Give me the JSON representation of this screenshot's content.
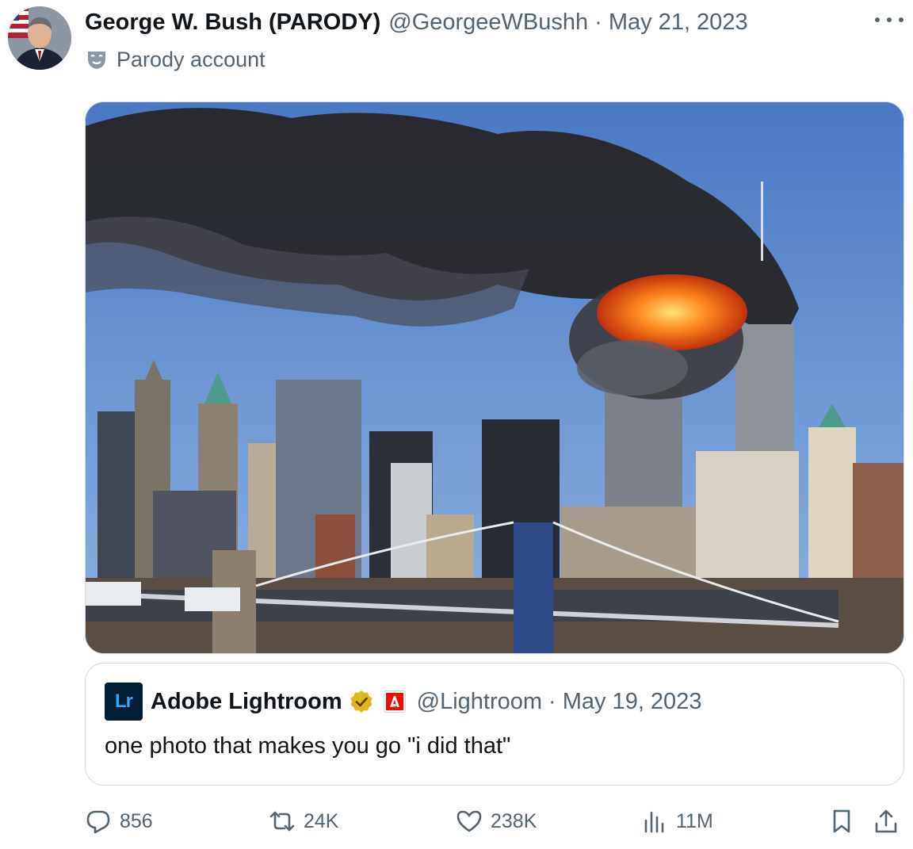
{
  "tweet": {
    "author_name": "George W. Bush (PARODY)",
    "handle": "@GeorgeeWBushh",
    "separator": "·",
    "date": "May 21, 2023",
    "parody_label": "Parody account"
  },
  "quoted_tweet": {
    "logo_text": "Lr",
    "author_name": "Adobe Lightroom",
    "handle": "@Lightroom",
    "separator": "·",
    "date": "May 19, 2023",
    "text": "one photo that makes you go \"i did that\""
  },
  "actions": {
    "replies": "856",
    "reposts": "24K",
    "likes": "238K",
    "views": "11M"
  },
  "icons": {
    "more": "more-horizontal-icon",
    "parody": "theater-mask-icon",
    "verified": "gold-verified-badge-icon",
    "affiliate": "adobe-affiliate-icon",
    "reply": "reply-icon",
    "repost": "repost-icon",
    "like": "heart-icon",
    "views": "views-chart-icon",
    "bookmark": "bookmark-icon",
    "share": "share-icon"
  },
  "colors": {
    "text_primary": "#0f1419",
    "text_secondary": "#536471",
    "border": "#cfd9de",
    "verified_gold": "#e2b719",
    "lightroom_bg": "#001e36",
    "lightroom_fg": "#31a8ff"
  }
}
